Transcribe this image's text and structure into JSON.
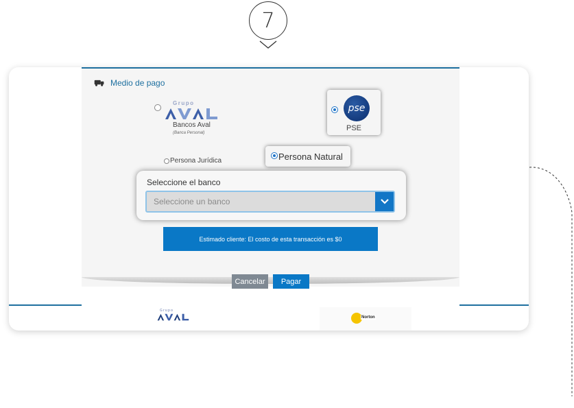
{
  "step": {
    "number": "7"
  },
  "payment": {
    "section_label": "Medio de pago",
    "aval": {
      "grupo_text": "Grupo",
      "logo_text": "AVAL",
      "label": "Bancos Aval",
      "sublabel": "(Banca Personal)"
    },
    "pse": {
      "logo_text": "pse",
      "label": "PSE",
      "selected": true
    },
    "person_type": {
      "juridica_label": "Persona Jurídica",
      "natural_label": "Persona Natural",
      "selected": "Persona Natural"
    },
    "bank_select": {
      "title": "Seleccione el banco",
      "placeholder": "Seleccione un banco"
    },
    "notice": "Estimado cliente: El costo de esta transacción es $0",
    "buttons": {
      "cancel": "Cancelar",
      "pay": "Pagar"
    }
  },
  "footer": {
    "aval_grupo": "Grupo",
    "aval_logo": "AVAL",
    "norton_label": "Norton"
  },
  "colors": {
    "primary_blue": "#0a78c6",
    "accent_line": "#1d6f9f",
    "cancel_gray": "#7f8993",
    "aval_blue": "#3d5fa8",
    "aval_light": "#9aa6c8"
  }
}
